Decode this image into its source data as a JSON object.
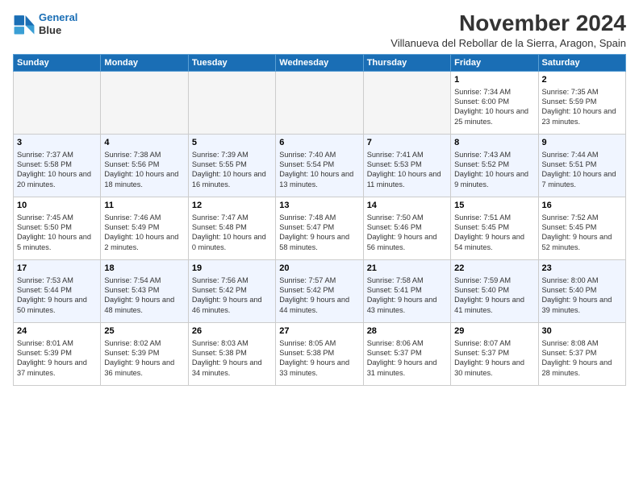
{
  "logo": {
    "line1": "General",
    "line2": "Blue"
  },
  "title": "November 2024",
  "subtitle": "Villanueva del Rebollar de la Sierra, Aragon, Spain",
  "days_of_week": [
    "Sunday",
    "Monday",
    "Tuesday",
    "Wednesday",
    "Thursday",
    "Friday",
    "Saturday"
  ],
  "weeks": [
    [
      {
        "day": "",
        "info": ""
      },
      {
        "day": "",
        "info": ""
      },
      {
        "day": "",
        "info": ""
      },
      {
        "day": "",
        "info": ""
      },
      {
        "day": "",
        "info": ""
      },
      {
        "day": "1",
        "info": "Sunrise: 7:34 AM\nSunset: 6:00 PM\nDaylight: 10 hours and 25 minutes."
      },
      {
        "day": "2",
        "info": "Sunrise: 7:35 AM\nSunset: 5:59 PM\nDaylight: 10 hours and 23 minutes."
      }
    ],
    [
      {
        "day": "3",
        "info": "Sunrise: 7:37 AM\nSunset: 5:58 PM\nDaylight: 10 hours and 20 minutes."
      },
      {
        "day": "4",
        "info": "Sunrise: 7:38 AM\nSunset: 5:56 PM\nDaylight: 10 hours and 18 minutes."
      },
      {
        "day": "5",
        "info": "Sunrise: 7:39 AM\nSunset: 5:55 PM\nDaylight: 10 hours and 16 minutes."
      },
      {
        "day": "6",
        "info": "Sunrise: 7:40 AM\nSunset: 5:54 PM\nDaylight: 10 hours and 13 minutes."
      },
      {
        "day": "7",
        "info": "Sunrise: 7:41 AM\nSunset: 5:53 PM\nDaylight: 10 hours and 11 minutes."
      },
      {
        "day": "8",
        "info": "Sunrise: 7:43 AM\nSunset: 5:52 PM\nDaylight: 10 hours and 9 minutes."
      },
      {
        "day": "9",
        "info": "Sunrise: 7:44 AM\nSunset: 5:51 PM\nDaylight: 10 hours and 7 minutes."
      }
    ],
    [
      {
        "day": "10",
        "info": "Sunrise: 7:45 AM\nSunset: 5:50 PM\nDaylight: 10 hours and 5 minutes."
      },
      {
        "day": "11",
        "info": "Sunrise: 7:46 AM\nSunset: 5:49 PM\nDaylight: 10 hours and 2 minutes."
      },
      {
        "day": "12",
        "info": "Sunrise: 7:47 AM\nSunset: 5:48 PM\nDaylight: 10 hours and 0 minutes."
      },
      {
        "day": "13",
        "info": "Sunrise: 7:48 AM\nSunset: 5:47 PM\nDaylight: 9 hours and 58 minutes."
      },
      {
        "day": "14",
        "info": "Sunrise: 7:50 AM\nSunset: 5:46 PM\nDaylight: 9 hours and 56 minutes."
      },
      {
        "day": "15",
        "info": "Sunrise: 7:51 AM\nSunset: 5:45 PM\nDaylight: 9 hours and 54 minutes."
      },
      {
        "day": "16",
        "info": "Sunrise: 7:52 AM\nSunset: 5:45 PM\nDaylight: 9 hours and 52 minutes."
      }
    ],
    [
      {
        "day": "17",
        "info": "Sunrise: 7:53 AM\nSunset: 5:44 PM\nDaylight: 9 hours and 50 minutes."
      },
      {
        "day": "18",
        "info": "Sunrise: 7:54 AM\nSunset: 5:43 PM\nDaylight: 9 hours and 48 minutes."
      },
      {
        "day": "19",
        "info": "Sunrise: 7:56 AM\nSunset: 5:42 PM\nDaylight: 9 hours and 46 minutes."
      },
      {
        "day": "20",
        "info": "Sunrise: 7:57 AM\nSunset: 5:42 PM\nDaylight: 9 hours and 44 minutes."
      },
      {
        "day": "21",
        "info": "Sunrise: 7:58 AM\nSunset: 5:41 PM\nDaylight: 9 hours and 43 minutes."
      },
      {
        "day": "22",
        "info": "Sunrise: 7:59 AM\nSunset: 5:40 PM\nDaylight: 9 hours and 41 minutes."
      },
      {
        "day": "23",
        "info": "Sunrise: 8:00 AM\nSunset: 5:40 PM\nDaylight: 9 hours and 39 minutes."
      }
    ],
    [
      {
        "day": "24",
        "info": "Sunrise: 8:01 AM\nSunset: 5:39 PM\nDaylight: 9 hours and 37 minutes."
      },
      {
        "day": "25",
        "info": "Sunrise: 8:02 AM\nSunset: 5:39 PM\nDaylight: 9 hours and 36 minutes."
      },
      {
        "day": "26",
        "info": "Sunrise: 8:03 AM\nSunset: 5:38 PM\nDaylight: 9 hours and 34 minutes."
      },
      {
        "day": "27",
        "info": "Sunrise: 8:05 AM\nSunset: 5:38 PM\nDaylight: 9 hours and 33 minutes."
      },
      {
        "day": "28",
        "info": "Sunrise: 8:06 AM\nSunset: 5:37 PM\nDaylight: 9 hours and 31 minutes."
      },
      {
        "day": "29",
        "info": "Sunrise: 8:07 AM\nSunset: 5:37 PM\nDaylight: 9 hours and 30 minutes."
      },
      {
        "day": "30",
        "info": "Sunrise: 8:08 AM\nSunset: 5:37 PM\nDaylight: 9 hours and 28 minutes."
      }
    ]
  ]
}
